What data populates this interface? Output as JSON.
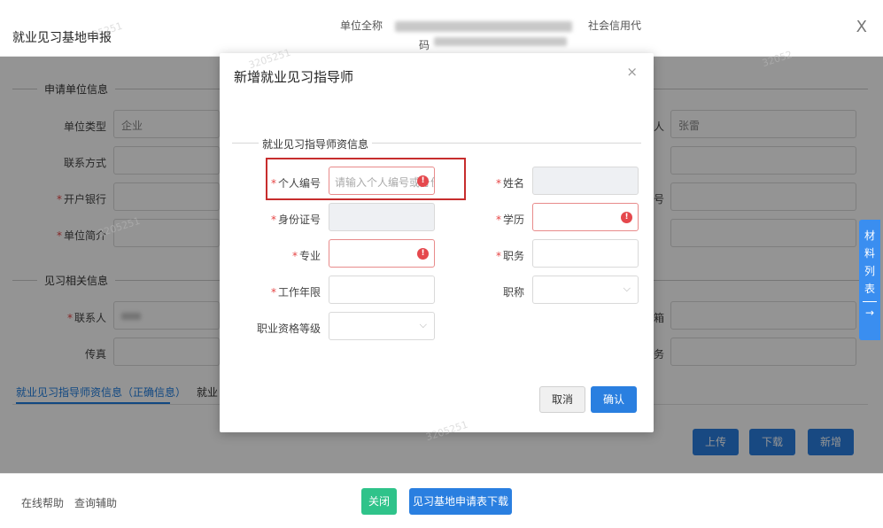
{
  "header": {
    "title": "就业见习基地申报",
    "unit_name_label": "单位全称",
    "credit_code_label": "社会信用代",
    "credit_code_label_cont": "码",
    "close_glyph": "X"
  },
  "background": {
    "section_applicant": "申请单位信息",
    "section_internship": "见习相关信息",
    "labels": {
      "unit_type": "单位类型",
      "contact_method": "联系方式",
      "bank": "开户银行",
      "unit_intro": "单位简介",
      "contact_person": "联系人",
      "fax": "传真",
      "legal_rep_suffix": "人",
      "account_suffix": "号",
      "email_suffix": "箱",
      "duty_suffix": "务"
    },
    "values": {
      "unit_type": "企业",
      "legal_rep": "张雷"
    },
    "tab_active": "就业见习指导师资信息（正确信息）",
    "tab_next": "就业",
    "btn_upload": "上传",
    "btn_download": "下载",
    "btn_add": "新增"
  },
  "side_tab": {
    "chars": [
      "材",
      "料",
      "列",
      "表"
    ],
    "arrow": "→"
  },
  "footer": {
    "help": "在线帮助",
    "query": "查询辅助",
    "close": "关闭",
    "download_form": "见习基地申请表下载"
  },
  "modal": {
    "title": "新增就业见习指导师",
    "close_glyph": "×",
    "section": "就业见习指导师资信息",
    "fields": {
      "personal_id": {
        "label": "个人编号",
        "placeholder": "请输入个人编号或身份证号"
      },
      "name": {
        "label": "姓名"
      },
      "id_card": {
        "label": "身份证号"
      },
      "education": {
        "label": "学历"
      },
      "major": {
        "label": "专业"
      },
      "position": {
        "label": "职务"
      },
      "work_years": {
        "label": "工作年限"
      },
      "title": {
        "label": "职称"
      },
      "qualification": {
        "label": "职业资格等级"
      }
    },
    "cancel": "取消",
    "confirm": "确认"
  },
  "colors": {
    "primary": "#2a7fe0",
    "success": "#2fc38a",
    "error": "#e5484d",
    "highlight": "#c72d2d"
  }
}
